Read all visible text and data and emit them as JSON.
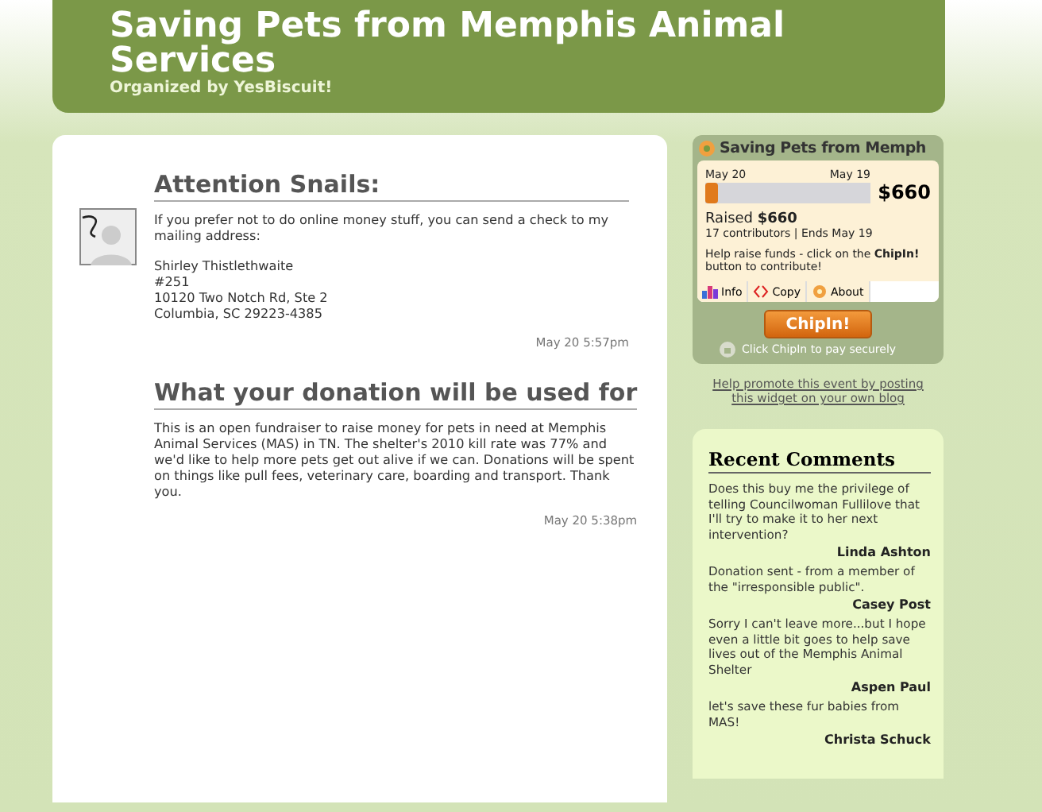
{
  "header": {
    "title": "Saving Pets from Memphis Animal Services",
    "subtitle": "Organized by YesBiscuit!"
  },
  "posts": [
    {
      "title": "Attention Snails:",
      "paragraphs": [
        "If you prefer not to do online money stuff, you can send a check to my mailing address:",
        "Shirley Thistlethwaite\n#251\n10120 Two Notch Rd, Ste 2\nColumbia, SC 29223-4385"
      ],
      "time": "May 20 5:57pm",
      "avatar": true
    },
    {
      "title": "What your donation will be used for",
      "paragraphs": [
        "This is an open fundraiser to raise money for pets in need at Memphis Animal Services (MAS) in TN. The shelter's 2010 kill rate was 77% and we'd like to help more pets get out alive if we can. Donations will be spent on things like pull fees, veterinary care, boarding and transport. Thank you."
      ],
      "time": "May 20 5:38pm",
      "avatar": false
    }
  ],
  "widget": {
    "title": "Saving Pets from Memph",
    "start": "May 20",
    "end": "May 19",
    "level": 0.08,
    "goal": "$660",
    "raised_label": "Raised",
    "raised": "$660",
    "stats": "17 contributors | Ends May 19",
    "help": "Help raise funds - click on the **ChipIn!** button to contribute!",
    "tabs": [
      {
        "label": "Info",
        "kind": "chart"
      },
      {
        "label": "Copy",
        "kind": "code"
      },
      {
        "label": "About",
        "kind": "flower"
      }
    ],
    "button": "ChipIn!",
    "secure": "Click ChipIn to pay securely"
  },
  "promo_link": "Help promote this event by posting this widget on your own blog",
  "recent_comments": {
    "title": "Recent Comments",
    "items": [
      {
        "text": "Does this buy me the privilege of telling Councilwoman Fullilove that I'll try to make it to her next intervention?",
        "author": "Linda Ashton"
      },
      {
        "text": "Donation sent - from a member of the \"irresponsible public\".",
        "author": "Casey Post"
      },
      {
        "text": "Sorry I can't leave more...but I hope even a little bit goes to help save lives out of the Memphis Animal Shelter",
        "author": "Aspen Paul"
      },
      {
        "text": "let's save these fur babies from MAS!",
        "author": "Christa Schuck"
      }
    ]
  }
}
